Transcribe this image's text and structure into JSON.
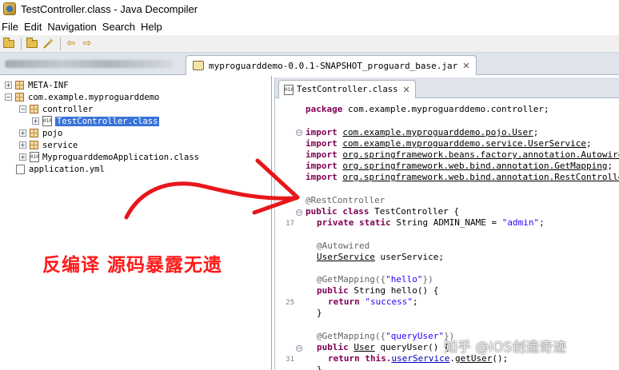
{
  "window": {
    "title": "TestController.class - Java Decompiler"
  },
  "menu": {
    "items": [
      "File",
      "Edit",
      "Navigation",
      "Search",
      "Help"
    ]
  },
  "file_tabs": {
    "active_label": "myproguarddemo-0.0.1-SNAPSHOT_proguard_base.jar"
  },
  "tree": {
    "rows": [
      {
        "label": "META-INF"
      },
      {
        "label": "com.example.myproguarddemo"
      },
      {
        "label": "controller"
      },
      {
        "label": "TestController.class"
      },
      {
        "label": "pojo"
      },
      {
        "label": "service"
      },
      {
        "label": "MyproguarddemoApplication.class"
      },
      {
        "label": "application.yml"
      }
    ]
  },
  "editor": {
    "tab_label": "TestController.class",
    "line_numbers": [
      "17",
      "25",
      "31"
    ],
    "lines": [
      [
        "package com.example.myproguarddemo.controller;"
      ],
      [
        "import ",
        "com.example.myproguarddemo.pojo.User",
        ";"
      ],
      [
        "import ",
        "com.example.myproguarddemo.service.UserService",
        ";"
      ],
      [
        "import ",
        "org.springframework.beans.factory.annotation.Autowired",
        ";"
      ],
      [
        "import ",
        "org.springframework.web.bind.annotation.GetMapping",
        ";"
      ],
      [
        "import ",
        "org.springframework.web.bind.annotation.RestController",
        ";"
      ],
      [
        "@RestController"
      ],
      [
        "public class TestController {"
      ],
      [
        "private static String ADMIN_NAME = ",
        "\"admin\"",
        ";"
      ],
      [
        "@Autowired"
      ],
      [
        "UserService",
        " userService;"
      ],
      [
        "@GetMapping({",
        "\"hello\"",
        "})"
      ],
      [
        "public String hello() {"
      ],
      [
        "return ",
        "\"success\"",
        ";"
      ],
      [
        "}"
      ],
      [
        "@GetMapping({",
        "\"queryUser\"",
        "})"
      ],
      [
        "public ",
        "User",
        " queryUser() {"
      ],
      [
        "return this.",
        "userService",
        ".",
        "getUser",
        "();"
      ]
    ]
  },
  "overlay": {
    "caption": "反编译 源码暴露无遗",
    "caption_color": "#ff1a1a",
    "watermark": "知乎 @iOS创造奇迹"
  },
  "colors": {
    "selection": "#3874d8",
    "keyword": "#7f0055",
    "string": "#2a00ff",
    "annotation": "#646464"
  }
}
